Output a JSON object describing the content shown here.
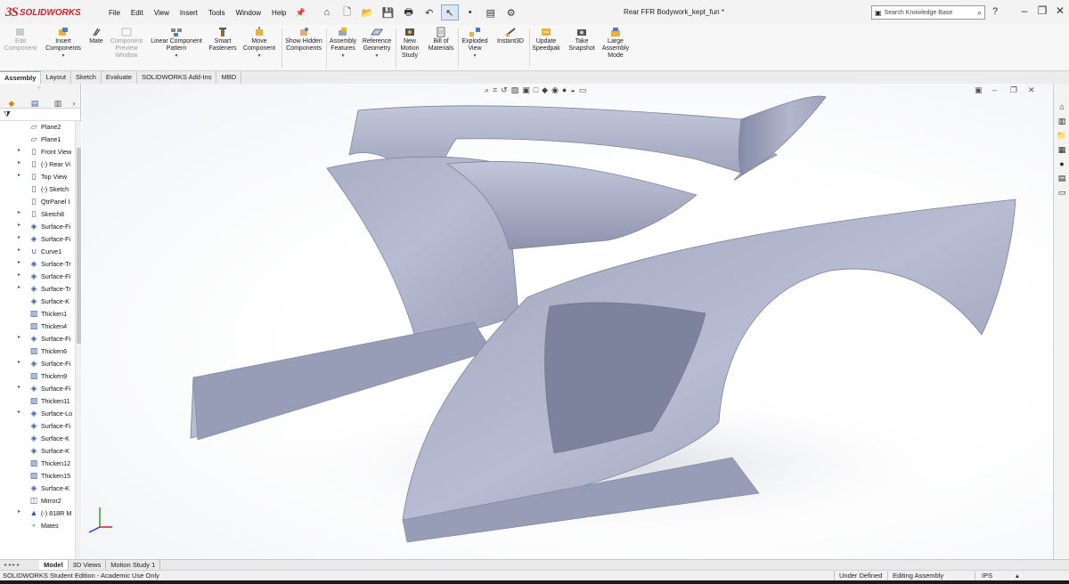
{
  "app": {
    "logo_ds": "3S",
    "logo_text": "SOLIDWORKS",
    "document_title": "Rear FFR Bodywork_kept_fun *"
  },
  "menu": [
    "File",
    "Edit",
    "View",
    "Insert",
    "Tools",
    "Window",
    "Help"
  ],
  "search": {
    "placeholder": "Search Knowledge Base"
  },
  "commands": {
    "edit_component": "Edit Component",
    "insert_components": "Insert Components",
    "mate": "Mate",
    "component_preview": "Component Preview Window",
    "linear_pattern": "Linear Component Pattern",
    "smart_fasteners": "Smart Fasteners",
    "move_component": "Move Component",
    "show_hidden": "Show Hidden Components",
    "assembly_features": "Assembly Features",
    "reference_geometry": "Reference Geometry",
    "new_motion_study": "New Motion Study",
    "bill_of_materials": "Bill of Materials",
    "exploded_view": "Exploded View",
    "instant3d": "Instant3D",
    "update_speedpak": "Update Speedpak",
    "take_snapshot": "Take Snapshot",
    "large_assembly_mode": "Large Assembly Mode"
  },
  "tabs": [
    "Assembly",
    "Layout",
    "Sketch",
    "Evaluate",
    "SOLIDWORKS Add-Ins",
    "MBD"
  ],
  "tree": [
    {
      "label": "Plane2",
      "exp": false,
      "icon": "plane-icon"
    },
    {
      "label": "Plane1",
      "exp": false,
      "icon": "plane-icon"
    },
    {
      "label": "Front View",
      "exp": true,
      "icon": "sketch-icon"
    },
    {
      "label": "(-) Rear Vi",
      "exp": true,
      "icon": "sketch-icon"
    },
    {
      "label": "Top View",
      "exp": true,
      "icon": "sketch-icon"
    },
    {
      "label": "(-) Sketch",
      "exp": false,
      "icon": "sketch-icon"
    },
    {
      "label": "QtrPanel I",
      "exp": false,
      "icon": "sketch-icon"
    },
    {
      "label": "Sketch8",
      "exp": true,
      "icon": "sketch-icon"
    },
    {
      "label": "Surface-Fi",
      "exp": true,
      "icon": "surface-icon"
    },
    {
      "label": "Surface-Fi",
      "exp": true,
      "icon": "surface-icon"
    },
    {
      "label": "Curve1",
      "exp": true,
      "icon": "curve-icon"
    },
    {
      "label": "Surface-Tr",
      "exp": true,
      "icon": "surface-icon"
    },
    {
      "label": "Surface-Fi",
      "exp": true,
      "icon": "surface-icon"
    },
    {
      "label": "Surface-Tr",
      "exp": true,
      "icon": "surface-icon"
    },
    {
      "label": "Surface-K",
      "exp": false,
      "icon": "surface-icon"
    },
    {
      "label": "Thicken1",
      "exp": false,
      "icon": "thicken-icon"
    },
    {
      "label": "Thicken4",
      "exp": false,
      "icon": "thicken-icon"
    },
    {
      "label": "Surface-Fi",
      "exp": true,
      "icon": "surface-icon"
    },
    {
      "label": "Thicken6",
      "exp": false,
      "icon": "thicken-icon"
    },
    {
      "label": "Surface-Fi",
      "exp": true,
      "icon": "surface-icon"
    },
    {
      "label": "Thicken9",
      "exp": false,
      "icon": "thicken-icon"
    },
    {
      "label": "Surface-Fi",
      "exp": true,
      "icon": "surface-icon"
    },
    {
      "label": "Thicken11",
      "exp": false,
      "icon": "thicken-icon"
    },
    {
      "label": "Surface-Lo",
      "exp": true,
      "icon": "surface-icon"
    },
    {
      "label": "Surface-Fi",
      "exp": false,
      "icon": "surface-icon"
    },
    {
      "label": "Surface-K",
      "exp": false,
      "icon": "surface-icon"
    },
    {
      "label": "Surface-K",
      "exp": false,
      "icon": "surface-icon"
    },
    {
      "label": "Thicken12",
      "exp": false,
      "icon": "thicken-icon"
    },
    {
      "label": "Thicken15",
      "exp": false,
      "icon": "thicken-icon"
    },
    {
      "label": "Surface-K",
      "exp": false,
      "icon": "surface-icon"
    },
    {
      "label": "Mirror2",
      "exp": false,
      "icon": "mirror-icon"
    },
    {
      "label": "(-) 818R M",
      "exp": true,
      "icon": "part-icon"
    },
    {
      "label": "Mates",
      "exp": false,
      "icon": "mates-icon"
    }
  ],
  "bottom_tabs": [
    "Model",
    "3D Views",
    "Motion Study 1"
  ],
  "status": {
    "edition": "SOLIDWORKS Student Edition - Academic Use Only",
    "under_defined": "Under Defined",
    "editing": "Editing Assembly",
    "units": "IPS"
  },
  "colors": {
    "accent": "#d4202a",
    "surface": "#a9aec6"
  }
}
